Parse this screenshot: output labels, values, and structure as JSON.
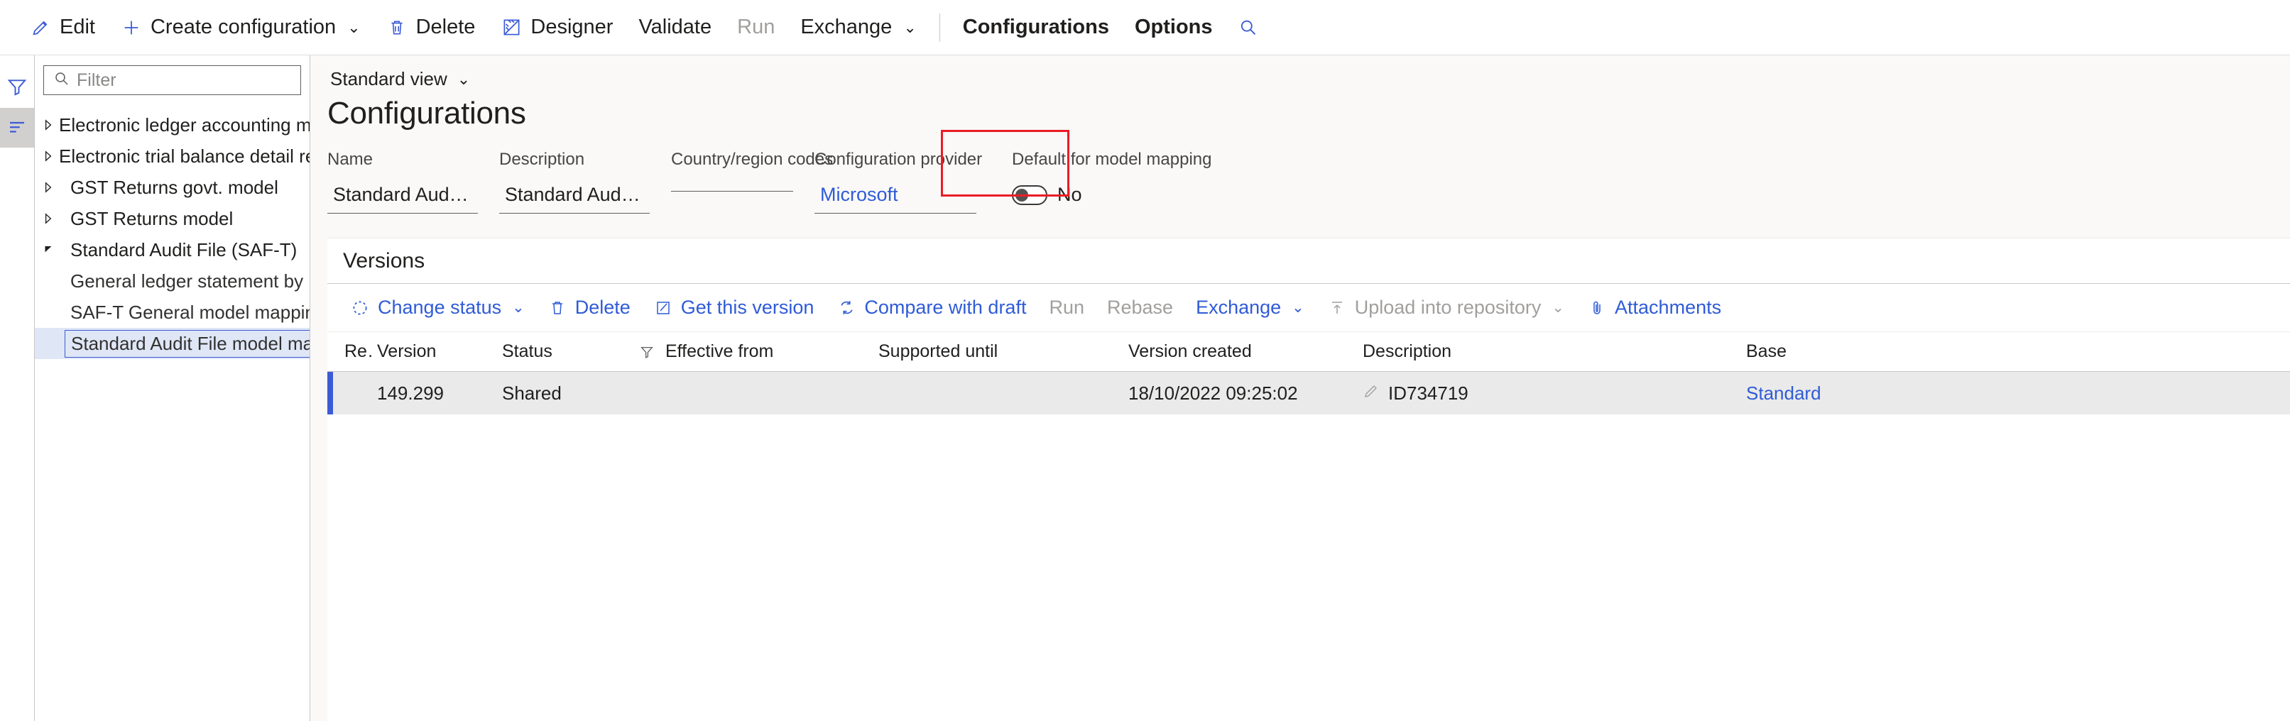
{
  "command_bar": {
    "items": [
      {
        "label": "Edit",
        "icon": "pencil-icon",
        "state": "enabled",
        "caret": false
      },
      {
        "label": "Create configuration",
        "icon": "plus-icon",
        "state": "enabled",
        "caret": true
      },
      {
        "label": "Delete",
        "icon": "trash-icon",
        "state": "enabled",
        "caret": false
      },
      {
        "label": "Designer",
        "icon": "designer-icon",
        "state": "enabled",
        "caret": false
      },
      {
        "label": "Validate",
        "icon": "none",
        "state": "enabled",
        "caret": false
      },
      {
        "label": "Run",
        "icon": "none",
        "state": "disabled",
        "caret": false
      },
      {
        "label": "Exchange",
        "icon": "none",
        "state": "enabled",
        "caret": true
      }
    ],
    "tabs": [
      {
        "label": "Configurations",
        "selected": true
      },
      {
        "label": "Options",
        "selected": false
      }
    ],
    "search_icon": "search-icon"
  },
  "rail": {
    "items": [
      {
        "name": "filter-icon",
        "active": false
      },
      {
        "name": "list-icon",
        "active": true
      }
    ]
  },
  "tree_panel": {
    "filter": {
      "value": "",
      "placeholder": "Filter",
      "icon": "search-icon"
    },
    "nodes": [
      {
        "label": "Electronic ledger accounting model MX",
        "level": 0,
        "expanded": false,
        "selected": false
      },
      {
        "label": "Electronic trial balance detail report model",
        "level": 0,
        "expanded": false,
        "selected": false
      },
      {
        "label": "GST Returns govt. model",
        "level": 0,
        "expanded": false,
        "selected": false
      },
      {
        "label": "GST Returns model",
        "level": 0,
        "expanded": false,
        "selected": false
      },
      {
        "label": "Standard Audit File (SAF-T)",
        "level": 0,
        "expanded": true,
        "selected": false
      },
      {
        "label": "General ledger statement by main account (Excel)",
        "level": 1,
        "expanded": null,
        "selected": false
      },
      {
        "label": "SAF-T General model mapping",
        "level": 1,
        "expanded": null,
        "selected": false
      },
      {
        "label": "Standard Audit File model mapping",
        "level": 1,
        "expanded": null,
        "selected": true
      }
    ]
  },
  "main": {
    "view_selector": "Standard view",
    "page_title": "Configurations",
    "fields": [
      {
        "label": "Name",
        "value": "Standard Audit File model map…",
        "link": false
      },
      {
        "label": "Description",
        "value": "Standard Audit File model map…",
        "link": false
      },
      {
        "label": "Country/region codes",
        "value": "",
        "link": false
      },
      {
        "label": "Configuration provider",
        "value": "Microsoft",
        "link": true
      }
    ],
    "default_mapping": {
      "label": "Default for model mapping",
      "toggle_value": "No",
      "toggle_on": false,
      "highlight_color": "#ec1c24"
    }
  },
  "versions": {
    "title": "Versions",
    "toolbar": [
      {
        "label": "Change status",
        "icon": "status-circle-icon",
        "state": "enabled",
        "caret": true
      },
      {
        "label": "Delete",
        "icon": "trash-icon",
        "state": "enabled",
        "caret": false
      },
      {
        "label": "Get this version",
        "icon": "get-version-icon",
        "state": "enabled",
        "caret": false
      },
      {
        "label": "Compare with draft",
        "icon": "compare-icon",
        "state": "enabled",
        "caret": false
      },
      {
        "label": "Run",
        "icon": "none",
        "state": "disabled",
        "caret": false
      },
      {
        "label": "Rebase",
        "icon": "none",
        "state": "disabled",
        "caret": false
      },
      {
        "label": "Exchange",
        "icon": "none",
        "state": "enabled",
        "caret": true
      },
      {
        "label": "Upload into repository",
        "icon": "upload-icon",
        "state": "disabled",
        "caret": true
      },
      {
        "label": "Attachments",
        "icon": "paperclip-icon",
        "state": "enabled",
        "caret": false
      }
    ],
    "columns": {
      "re": "Re…",
      "version": "Version",
      "status": "Status",
      "filter_icon": "filter-icon",
      "effective_from": "Effective from",
      "supported_until": "Supported until",
      "version_created": "Version created",
      "description": "Description",
      "base": "Base"
    },
    "rows": [
      {
        "re": "",
        "version": "149.299",
        "status": "Shared",
        "effective_from": "",
        "supported_until": "",
        "version_created": "18/10/2022 09:25:02",
        "description": "ID734719",
        "base": "Standard",
        "selected": true
      }
    ]
  }
}
